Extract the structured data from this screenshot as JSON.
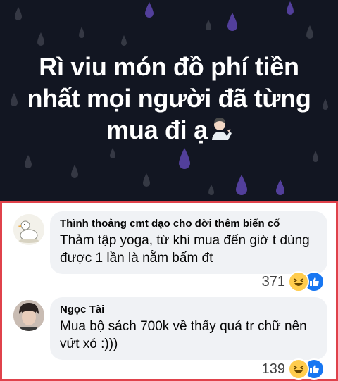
{
  "post": {
    "text_line1": "Rì viu món đồ phí tiền",
    "text_line2": "nhất mọi người đã từng",
    "text_line3": "mua đi ạ",
    "emoji": "person-tipping-hand-icon",
    "background_color": "#121622",
    "drop_color": "#5b46a6"
  },
  "comments": [
    {
      "author": "Thình thoảng cmt dạo cho đời thêm biến cố",
      "text_line1": "Thảm tập yoga, từ khi mua đến giờ t dùng",
      "text_line2": "được 1 lần là nằm bấm đt",
      "reaction_count": "371",
      "reactions": [
        "haha-icon",
        "like-icon"
      ]
    },
    {
      "author": "Ngọc Tài",
      "text_line1": "Mua bộ sách 700k về thấy quá tr chữ nên",
      "text_line2": "vứt xó :)))",
      "reaction_count": "139",
      "reactions": [
        "haha-icon",
        "like-icon"
      ]
    }
  ],
  "colors": {
    "highlight_border": "#e0424b",
    "bubble": "#f0f2f5",
    "like": "#1877f2",
    "haha": "#ffcc4d"
  }
}
